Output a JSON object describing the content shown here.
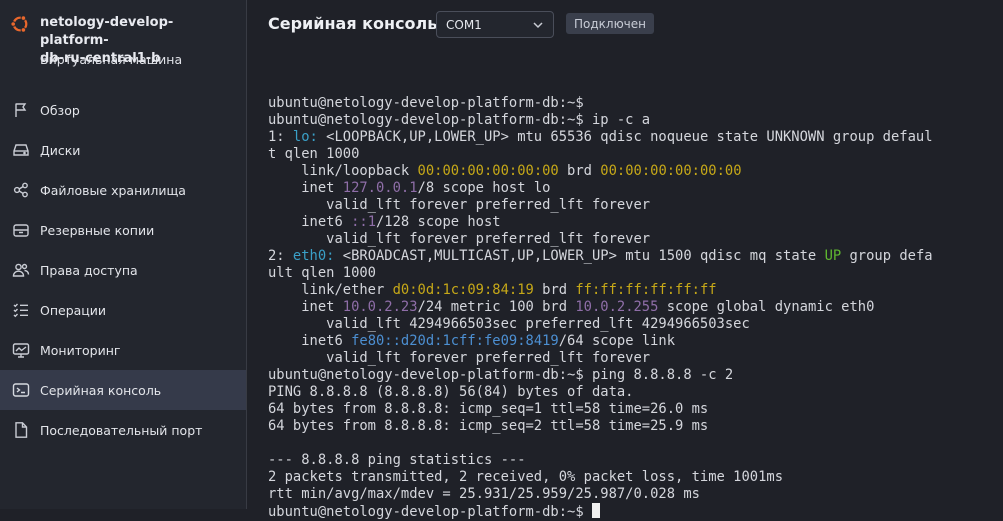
{
  "vm": {
    "title_line1": "netology-develop-platform-",
    "title_line2": "db-ru-central1-b",
    "subtitle": "Виртуальная машина"
  },
  "nav": [
    {
      "label": "Обзор",
      "icon": "flag-icon"
    },
    {
      "label": "Диски",
      "icon": "disk-icon"
    },
    {
      "label": "Файловые хранилища",
      "icon": "file-storage-icon"
    },
    {
      "label": "Резервные копии",
      "icon": "backup-icon"
    },
    {
      "label": "Права доступа",
      "icon": "users-icon"
    },
    {
      "label": "Операции",
      "icon": "list-check-icon"
    },
    {
      "label": "Мониторинг",
      "icon": "monitor-icon"
    },
    {
      "label": "Серийная консоль",
      "icon": "console-icon",
      "active": true
    },
    {
      "label": "Последовательный порт",
      "icon": "document-icon"
    }
  ],
  "header": {
    "title": "Серийная консоль",
    "port_select": "COM1",
    "status": "Подключен"
  },
  "terminal": [
    [
      {
        "t": ""
      }
    ],
    [
      {
        "t": "ubuntu@netology-develop-platform-db:~$"
      }
    ],
    [
      {
        "t": "ubuntu@netology-develop-platform-db:~$ ip -c a"
      }
    ],
    [
      {
        "t": "1: "
      },
      {
        "t": "lo:",
        "c": "blue"
      },
      {
        "t": " <LOOPBACK,UP,LOWER_UP> mtu 65536 qdisc noqueue state UNKNOWN group defaul"
      }
    ],
    [
      {
        "t": "t qlen 1000"
      }
    ],
    [
      {
        "t": "    link/loopback "
      },
      {
        "t": "00:00:00:00:00:00",
        "c": "yellow"
      },
      {
        "t": " brd "
      },
      {
        "t": "00:00:00:00:00:00",
        "c": "yellow"
      }
    ],
    [
      {
        "t": "    inet "
      },
      {
        "t": "127.0.0.1",
        "c": "purple"
      },
      {
        "t": "/8 scope host lo"
      }
    ],
    [
      {
        "t": "       valid_lft forever preferred_lft forever"
      }
    ],
    [
      {
        "t": "    inet6 "
      },
      {
        "t": "::1",
        "c": "purple"
      },
      {
        "t": "/128 scope host"
      }
    ],
    [
      {
        "t": "       valid_lft forever preferred_lft forever"
      }
    ],
    [
      {
        "t": "2: "
      },
      {
        "t": "eth0:",
        "c": "blue"
      },
      {
        "t": " <BROADCAST,MULTICAST,UP,LOWER_UP> mtu 1500 qdisc mq state "
      },
      {
        "t": "UP",
        "c": "green"
      },
      {
        "t": " group defa"
      }
    ],
    [
      {
        "t": "ult qlen 1000"
      }
    ],
    [
      {
        "t": "    link/ether "
      },
      {
        "t": "d0:0d:1c:09:84:19",
        "c": "yellow"
      },
      {
        "t": " brd "
      },
      {
        "t": "ff:ff:ff:ff:ff:ff",
        "c": "yellow"
      }
    ],
    [
      {
        "t": "    inet "
      },
      {
        "t": "10.0.2.23",
        "c": "purple"
      },
      {
        "t": "/24 metric 100 brd "
      },
      {
        "t": "10.0.2.255",
        "c": "purple"
      },
      {
        "t": " scope global dynamic eth0"
      }
    ],
    [
      {
        "t": "       valid_lft 4294966503sec preferred_lft 4294966503sec"
      }
    ],
    [
      {
        "t": "    inet6 "
      },
      {
        "t": "fe80::d20d:1cff:fe09:8419",
        "c": "lblue"
      },
      {
        "t": "/64 scope link"
      }
    ],
    [
      {
        "t": "       valid_lft forever preferred_lft forever"
      }
    ],
    [
      {
        "t": "ubuntu@netology-develop-platform-db:~$ ping 8.8.8.8 -c 2"
      }
    ],
    [
      {
        "t": "PING 8.8.8.8 (8.8.8.8) 56(84) bytes of data."
      }
    ],
    [
      {
        "t": "64 bytes from 8.8.8.8: icmp_seq=1 ttl=58 time=26.0 ms"
      }
    ],
    [
      {
        "t": "64 bytes from 8.8.8.8: icmp_seq=2 ttl=58 time=25.9 ms"
      }
    ],
    [
      {
        "t": ""
      }
    ],
    [
      {
        "t": "--- 8.8.8.8 ping statistics ---"
      }
    ],
    [
      {
        "t": "2 packets transmitted, 2 received, 0% packet loss, time 1001ms"
      }
    ],
    [
      {
        "t": "rtt min/avg/max/mdev = 25.931/25.959/25.987/0.028 ms"
      }
    ],
    [
      {
        "t": "ubuntu@netology-develop-platform-db:~$ "
      },
      {
        "cursor": true
      }
    ]
  ],
  "colors": {
    "blue": "#3aa0c8",
    "yellow": "#c6a818",
    "purple": "#8f6ea8",
    "green": "#5fb830",
    "lblue": "#4c8fd2",
    "logo": "#e9672c"
  }
}
